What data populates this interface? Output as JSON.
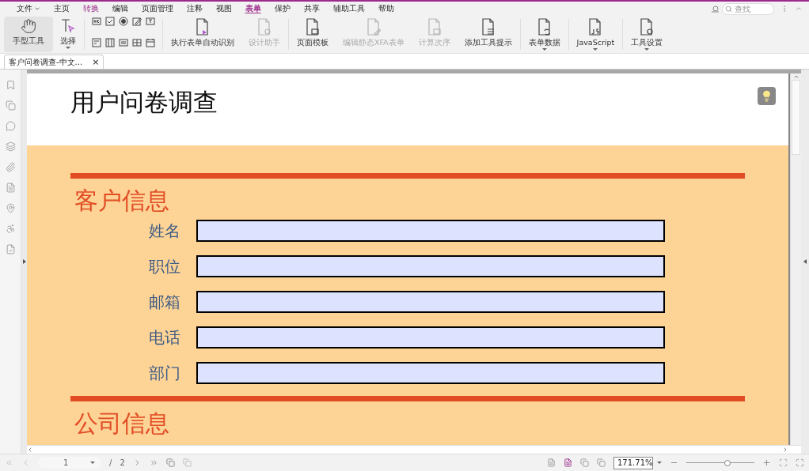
{
  "menu": [
    {
      "label": "文件",
      "selected": false,
      "highlighted": false,
      "dropdown": true
    },
    {
      "label": "主页",
      "selected": false,
      "highlighted": false,
      "dropdown": false
    },
    {
      "label": "转换",
      "selected": false,
      "highlighted": true,
      "dropdown": false
    },
    {
      "label": "编辑",
      "selected": false,
      "highlighted": false,
      "dropdown": false
    },
    {
      "label": "页面管理",
      "selected": false,
      "highlighted": false,
      "dropdown": false
    },
    {
      "label": "注释",
      "selected": false,
      "highlighted": false,
      "dropdown": false
    },
    {
      "label": "视图",
      "selected": false,
      "highlighted": false,
      "dropdown": false
    },
    {
      "label": "表单",
      "selected": true,
      "highlighted": true,
      "dropdown": false
    },
    {
      "label": "保护",
      "selected": false,
      "highlighted": false,
      "dropdown": false
    },
    {
      "label": "共享",
      "selected": false,
      "highlighted": false,
      "dropdown": false
    },
    {
      "label": "辅助工具",
      "selected": false,
      "highlighted": false,
      "dropdown": false
    },
    {
      "label": "帮助",
      "selected": false,
      "highlighted": false,
      "dropdown": false
    }
  ],
  "search": {
    "placeholder": "查找"
  },
  "ribbon": [
    {
      "kind": "tool",
      "label": "手型工具",
      "selected": true,
      "disabled": false,
      "dropdown": false
    },
    {
      "kind": "tool",
      "label": "选择",
      "selected": false,
      "disabled": false,
      "dropdown": true
    },
    {
      "kind": "grid"
    },
    {
      "kind": "tool",
      "label": "执行表单自动识别",
      "selected": false,
      "disabled": false,
      "dropdown": false
    },
    {
      "kind": "tool",
      "label": "设计助手",
      "selected": false,
      "disabled": true,
      "dropdown": false
    },
    {
      "kind": "tool",
      "label": "页面模板",
      "selected": false,
      "disabled": false,
      "dropdown": false
    },
    {
      "kind": "tool",
      "label": "编辑静态XFA表单",
      "selected": false,
      "disabled": true,
      "dropdown": false
    },
    {
      "kind": "tool",
      "label": "计算次序",
      "selected": false,
      "disabled": true,
      "dropdown": false
    },
    {
      "kind": "tool",
      "label": "添加工具提示",
      "selected": false,
      "disabled": false,
      "dropdown": false
    },
    {
      "kind": "tool",
      "label": "表单数据",
      "selected": false,
      "disabled": false,
      "dropdown": true
    },
    {
      "kind": "tool",
      "label": "JavaScript",
      "selected": false,
      "disabled": false,
      "dropdown": true
    },
    {
      "kind": "tool",
      "label": "工具设置",
      "selected": false,
      "disabled": false,
      "dropdown": true
    }
  ],
  "tabs": [
    {
      "label": "客户问卷调查-中文...",
      "selected": true,
      "close": "×"
    }
  ],
  "document": {
    "title": "用户问卷调查",
    "sections": [
      {
        "title": "客户信息",
        "fields": [
          {
            "label": "姓名"
          },
          {
            "label": "职位"
          },
          {
            "label": "邮箱"
          },
          {
            "label": "电话"
          },
          {
            "label": "部门"
          }
        ]
      },
      {
        "title": "公司信息"
      }
    ]
  },
  "status": {
    "page": "1",
    "separator": "/",
    "total": "2",
    "zoom": "171.71%",
    "zoom_slider": {
      "level": 0.6
    }
  }
}
